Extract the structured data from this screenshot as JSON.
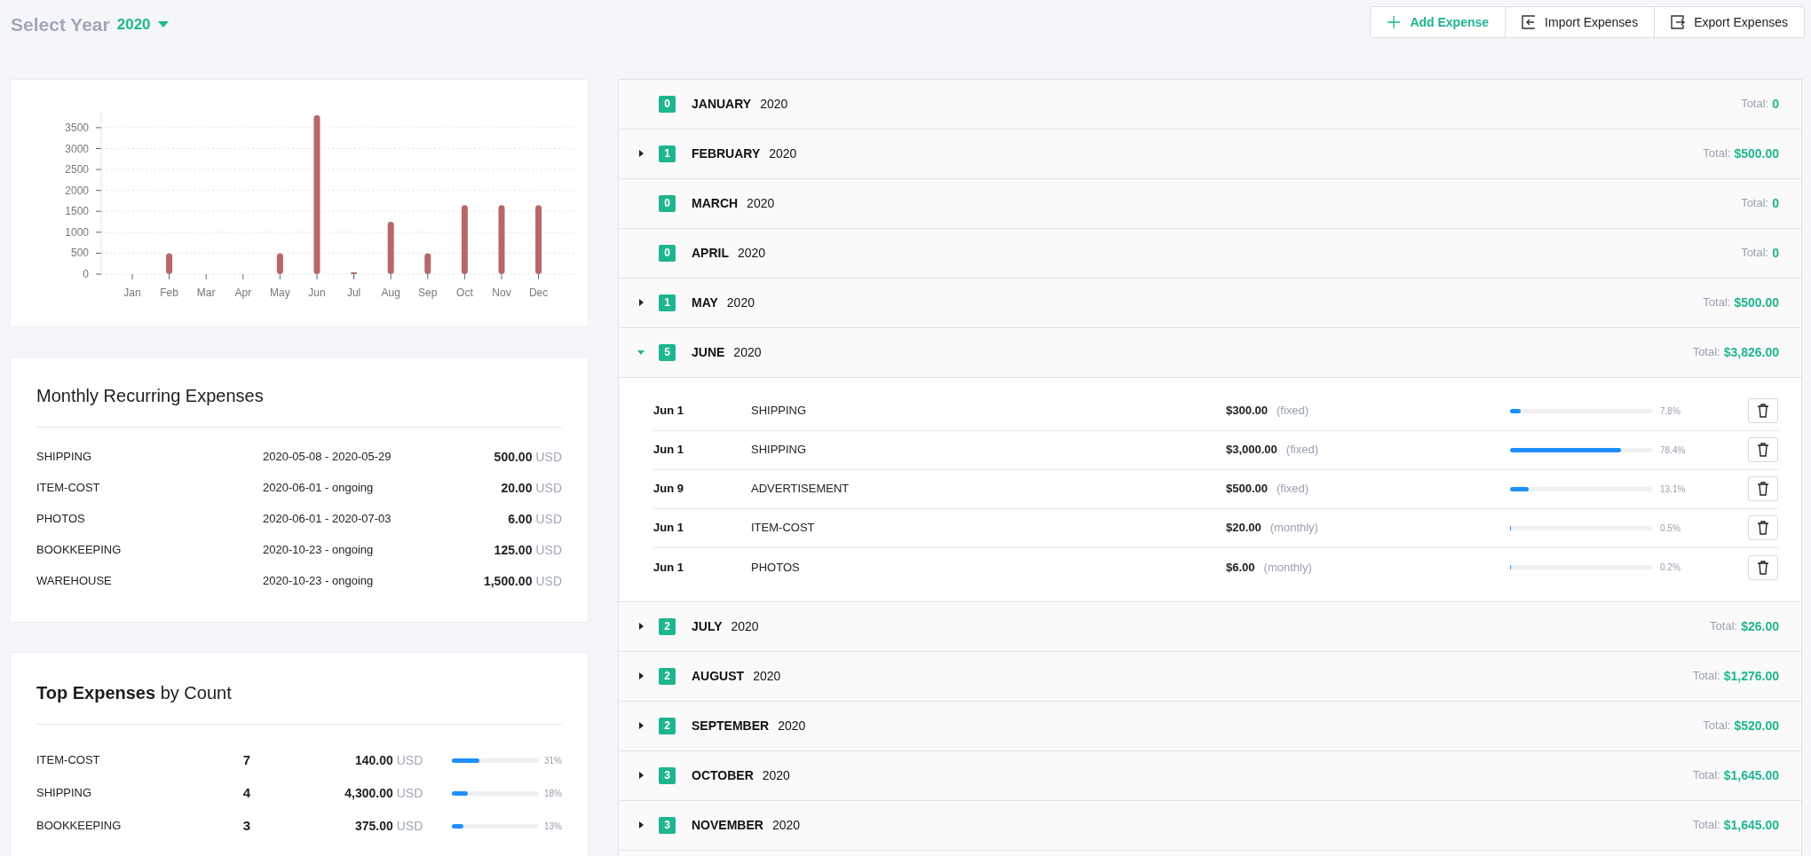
{
  "header": {
    "label": "Select Year",
    "year": "2020"
  },
  "actions": [
    {
      "kind": "add",
      "label": "Add Expense"
    },
    {
      "kind": "import",
      "label": "Import Expenses"
    },
    {
      "kind": "export",
      "label": "Export Expenses"
    }
  ],
  "chart_data": {
    "type": "bar",
    "categories": [
      "Jan",
      "Feb",
      "Mar",
      "Apr",
      "May",
      "Jun",
      "Jul",
      "Aug",
      "Sep",
      "Oct",
      "Nov",
      "Dec"
    ],
    "series": [
      {
        "color": "#b86767",
        "values": [
          0,
          500,
          0,
          0,
          500,
          3800,
          25,
          1250,
          500,
          1650,
          1650,
          1650
        ]
      }
    ],
    "ylim": [
      0,
      3880
    ],
    "yticks": [
      0,
      500,
      1000,
      1500,
      2000,
      2500,
      3000,
      3500
    ],
    "grid": true
  },
  "recurring": {
    "title": "Monthly Recurring Expenses",
    "rows": [
      {
        "name": "SHIPPING",
        "period": "2020-05-08 - 2020-05-29",
        "amount": "500.00",
        "currency": "USD"
      },
      {
        "name": "ITEM-COST",
        "period": "2020-06-01 - ongoing",
        "amount": "20.00",
        "currency": "USD"
      },
      {
        "name": "PHOTOS",
        "period": "2020-06-01 - 2020-07-03",
        "amount": "6.00",
        "currency": "USD"
      },
      {
        "name": "BOOKKEEPING",
        "period": "2020-10-23 - ongoing",
        "amount": "125.00",
        "currency": "USD"
      },
      {
        "name": "WAREHOUSE",
        "period": "2020-10-23 - ongoing",
        "amount": "1,500.00",
        "currency": "USD"
      }
    ]
  },
  "top": {
    "title": "**Top Expenses** by Count",
    "rows": [
      {
        "name": "ITEM-COST",
        "count": "7",
        "amount": "140.00",
        "currency": "USD",
        "level": 0.31,
        "percent": "31%"
      },
      {
        "name": "SHIPPING",
        "count": "4",
        "amount": "4,300.00",
        "currency": "USD",
        "level": 0.18,
        "percent": "18%"
      },
      {
        "name": "BOOKKEEPING",
        "count": "3",
        "amount": "375.00",
        "currency": "USD",
        "level": 0.13,
        "percent": "13%"
      }
    ]
  },
  "months": [
    {
      "name": "JANUARY",
      "year": "2020",
      "count": "0",
      "total_label": "Total:",
      "total": "0"
    },
    {
      "name": "FEBRUARY",
      "year": "2020",
      "count": "1",
      "total_label": "Total:",
      "total": "$500.00",
      "expanded": false
    },
    {
      "name": "MARCH",
      "year": "2020",
      "count": "0",
      "total_label": "Total:",
      "total": "0"
    },
    {
      "name": "APRIL",
      "year": "2020",
      "count": "0",
      "total_label": "Total:",
      "total": "0"
    },
    {
      "name": "MAY",
      "year": "2020",
      "count": "1",
      "total_label": "Total:",
      "total": "$500.00",
      "expanded": false
    },
    {
      "name": "JUNE",
      "year": "2020",
      "count": "5",
      "total_label": "Total:",
      "total": "$3,826.00",
      "expanded": true,
      "expenses": [
        {
          "date": "Jun 1",
          "name": "SHIPPING",
          "amount": "$300.00",
          "type": "(fixed)",
          "level": 0.078,
          "percent": "7.8%"
        },
        {
          "date": "Jun 1",
          "name": "SHIPPING",
          "amount": "$3,000.00",
          "type": "(fixed)",
          "level": 0.784,
          "percent": "78.4%"
        },
        {
          "date": "Jun 9",
          "name": "ADVERTISEMENT",
          "amount": "$500.00",
          "type": "(fixed)",
          "level": 0.131,
          "percent": "13.1%"
        },
        {
          "date": "Jun 1",
          "name": "ITEM-COST",
          "amount": "$20.00",
          "type": "(monthly)",
          "level": 0.005,
          "percent": "0.5%"
        },
        {
          "date": "Jun 1",
          "name": "PHOTOS",
          "amount": "$6.00",
          "type": "(monthly)",
          "level": 0.002,
          "percent": "0.2%"
        }
      ]
    },
    {
      "name": "JULY",
      "year": "2020",
      "count": "2",
      "total_label": "Total:",
      "total": "$26.00",
      "expanded": false
    },
    {
      "name": "AUGUST",
      "year": "2020",
      "count": "2",
      "total_label": "Total:",
      "total": "$1,276.00",
      "expanded": false
    },
    {
      "name": "SEPTEMBER",
      "year": "2020",
      "count": "2",
      "total_label": "Total:",
      "total": "$520.00",
      "expanded": false
    },
    {
      "name": "OCTOBER",
      "year": "2020",
      "count": "3",
      "total_label": "Total:",
      "total": "$1,645.00",
      "expanded": false
    },
    {
      "name": "NOVEMBER",
      "year": "2020",
      "count": "3",
      "total_label": "Total:",
      "total": "$1,645.00",
      "expanded": false
    }
  ]
}
